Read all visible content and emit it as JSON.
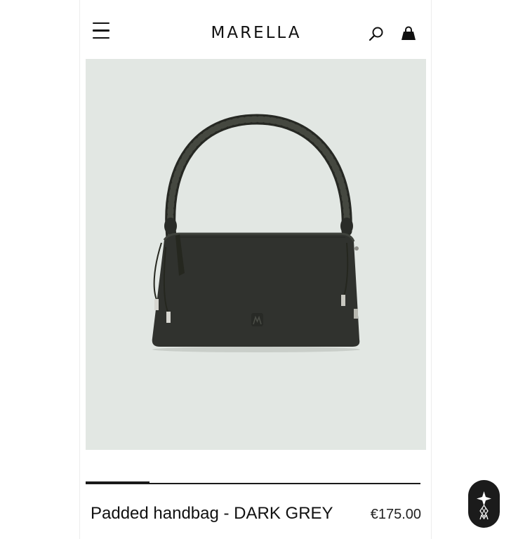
{
  "header": {
    "logo": "MARELLA",
    "icons": [
      "hamburger-menu-icon",
      "search-icon",
      "shopping-bag-icon"
    ]
  },
  "product": {
    "name": "Padded handbag - DARK GREY",
    "price": "€175.00",
    "image_background": "#e2e7e3",
    "bag_color": "#2f312d"
  },
  "carousel": {
    "current_slide": 1
  },
  "colors": {
    "text": "#111111",
    "assistant_button": "#1b1b1b"
  }
}
